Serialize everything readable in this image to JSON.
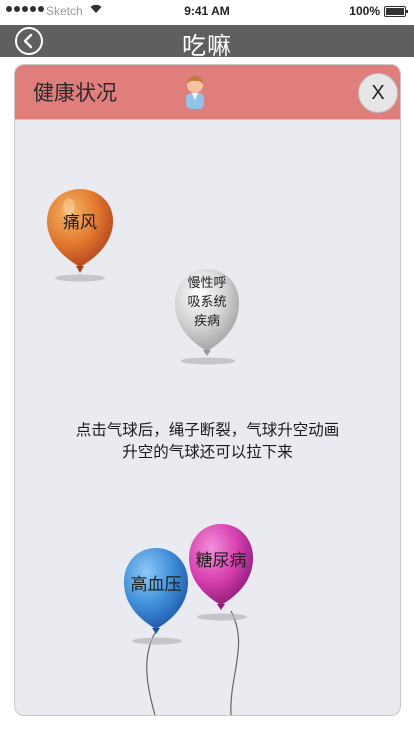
{
  "status_bar": {
    "carrier": "Sketch",
    "time": "9:41 AM",
    "battery": "100%"
  },
  "nav": {
    "title": "吃嘛"
  },
  "card": {
    "title": "健康状况",
    "close_label": "X",
    "instructions": [
      "点击气球后，绳子断裂，气球升空动画",
      "升空的气球还可以拉下来"
    ],
    "balloons": [
      {
        "label": "痛风",
        "color": "#e2782e"
      },
      {
        "label_lines": [
          "慢性呼",
          "吸系统",
          "疾病"
        ],
        "color": "#cfcfcf"
      },
      {
        "label": "高血压",
        "color": "#3f8fd9"
      },
      {
        "label": "糖尿病",
        "color": "#d83fb0"
      }
    ]
  }
}
